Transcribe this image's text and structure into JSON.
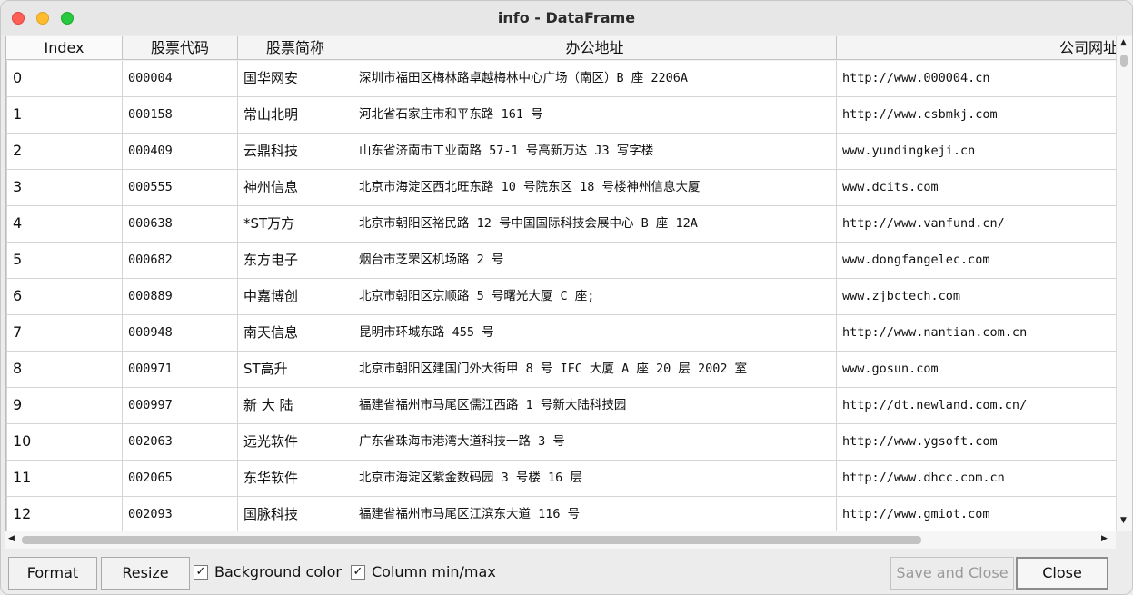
{
  "window": {
    "title": "info - DataFrame"
  },
  "table": {
    "columns": [
      "Index",
      "股票代码",
      "股票简称",
      "办公地址",
      "公司网址"
    ],
    "rows": [
      [
        "0",
        "000004",
        "国华网安",
        "深圳市福田区梅林路卓越梅林中心广场（南区）B 座 2206A",
        "http://www.000004.cn"
      ],
      [
        "1",
        "000158",
        "常山北明",
        "河北省石家庄市和平东路 161 号",
        "http://www.csbmkj.com"
      ],
      [
        "2",
        "000409",
        "云鼎科技",
        "山东省济南市工业南路 57-1 号高新万达 J3 写字楼",
        "www.yundingkeji.cn"
      ],
      [
        "3",
        "000555",
        "神州信息",
        "北京市海淀区西北旺东路 10 号院东区 18 号楼神州信息大厦",
        "www.dcits.com"
      ],
      [
        "4",
        "000638",
        "*ST万方",
        "北京市朝阳区裕民路 12 号中国国际科技会展中心 B 座 12A",
        "http://www.vanfund.cn/"
      ],
      [
        "5",
        "000682",
        "东方电子",
        "烟台市芝罘区机场路 2 号",
        "www.dongfangelec.com"
      ],
      [
        "6",
        "000889",
        "中嘉博创",
        "北京市朝阳区京顺路 5 号曙光大厦 C 座;",
        "www.zjbctech.com"
      ],
      [
        "7",
        "000948",
        "南天信息",
        "昆明市环城东路 455 号",
        "http://www.nantian.com.cn"
      ],
      [
        "8",
        "000971",
        "ST高升",
        "北京市朝阳区建国门外大街甲 8 号 IFC 大厦 A 座 20 层 2002 室",
        "www.gosun.com"
      ],
      [
        "9",
        "000997",
        "新 大 陆",
        "福建省福州市马尾区儒江西路 1 号新大陆科技园",
        "http://dt.newland.com.cn/"
      ],
      [
        "10",
        "002063",
        "远光软件",
        "广东省珠海市港湾大道科技一路 3 号",
        "http://www.ygsoft.com"
      ],
      [
        "11",
        "002065",
        "东华软件",
        "北京市海淀区紫金数码园 3 号楼 16 层",
        "http://www.dhcc.com.cn"
      ],
      [
        "12",
        "002093",
        "国脉科技",
        "福建省福州市马尾区江滨东大道 116 号",
        "http://www.gmiot.com"
      ]
    ]
  },
  "buttons": {
    "format": "Format",
    "resize": "Resize",
    "save_close": "Save and Close",
    "close": "Close"
  },
  "checkboxes": {
    "background_color": {
      "label": "Background color",
      "checked": true
    },
    "column_minmax": {
      "label": "Column min/max",
      "checked": true
    }
  },
  "scroll": {
    "up": "▲",
    "down": "▼",
    "left": "◀",
    "right": "▶"
  },
  "check_glyph": "✓"
}
